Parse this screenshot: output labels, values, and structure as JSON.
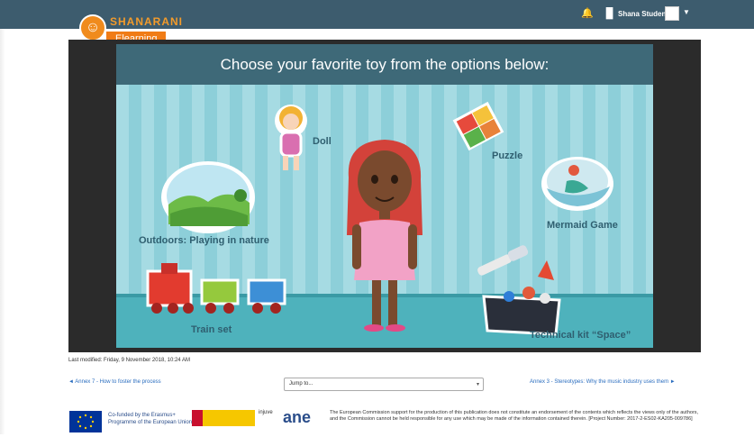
{
  "brand": {
    "name": "SHANARANI",
    "badge": "Elearning"
  },
  "user": {
    "name": "Shana Student"
  },
  "activity": {
    "title": "Choose your favorite toy from the options below:",
    "options": {
      "doll": "Doll",
      "puzzle": "Puzzle",
      "outdoors": "Outdoors: Playing in nature",
      "mermaid": "Mermaid Game",
      "train": "Train set",
      "space": "Technical kit “Space”"
    }
  },
  "meta": {
    "last_modified": "Last modified: Friday, 9 November 2018, 10:24 AM"
  },
  "nav": {
    "prev": "◄ Annex 7 - How to foster the process",
    "jump_label": "Jump to...",
    "next": "Annex 3 - Stereotypes: Why the music industry uses them ►"
  },
  "footer": {
    "eu_text": "Co-funded by the Erasmus+ Programme of the European Union",
    "injuve": "injuve",
    "ane": "ane",
    "disclaimer": "The European Commission support for the production of this publication does not constitute an endorsement of the contents which reflects the views only of the authors, and the Commission cannot be held responsible for any use which may be made of the information contained therein. [Project Number: 2017-2-ES02-KA205-009786]"
  },
  "colors": {
    "topbar": "#3d5c6e",
    "brand_orange": "#f07c16",
    "banner": "#3e6978",
    "label": "#2f5f70"
  }
}
